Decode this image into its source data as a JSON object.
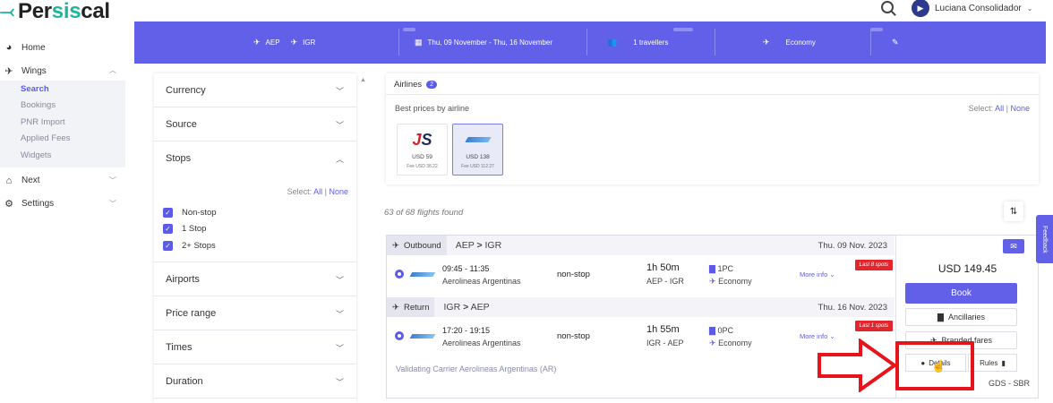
{
  "app": {
    "logo_prefix": "Per",
    "logo_accent": "sis",
    "logo_suffix": "cal"
  },
  "user": {
    "name": "Luciana Consolidador"
  },
  "sidebar": {
    "home": "Home",
    "wings": "Wings",
    "wings_items": [
      "Search",
      "Bookings",
      "PNR Import",
      "Applied Fees",
      "Widgets"
    ],
    "next": "Next",
    "settings": "Settings"
  },
  "searchbar": {
    "origin": "AEP",
    "destination": "IGR",
    "dates": "Thu, 09 November - Thu, 16 November",
    "travellers": "1 travellers",
    "cabin": "Economy"
  },
  "filters": {
    "currency": "Currency",
    "source": "Source",
    "stops": "Stops",
    "select_label": "Select:",
    "all": "All",
    "sep": "|",
    "none": "None",
    "stop_options": [
      "Non-stop",
      "1 Stop",
      "2+ Stops"
    ],
    "airports": "Airports",
    "price_range": "Price range",
    "times": "Times",
    "duration": "Duration"
  },
  "airlines": {
    "tab": "Airlines",
    "badge": "2",
    "best": "Best prices by airline",
    "select_label": "Select:",
    "all": "All",
    "sep": "|",
    "none": "None",
    "cards": [
      {
        "logo_a": "J",
        "logo_b": "S",
        "price": "USD 59",
        "fee": "Fee USD 38.22"
      },
      {
        "price": "USD 138",
        "fee": "Fee USD 112.27"
      }
    ]
  },
  "results": {
    "found": "63 of 68 flights found",
    "outbound": {
      "label": "Outbound",
      "from": "AEP",
      "arrow": ">",
      "to": "IGR",
      "date": "Thu. 09 Nov. 2023",
      "time": "09:45 - 11:35",
      "airline": "Aerolineas Argentinas",
      "stops": "non-stop",
      "duration": "1h 50m",
      "airports": "AEP - IGR",
      "bag": "1PC",
      "cabin": "Economy",
      "more": "More info",
      "last": "Last 8 spots"
    },
    "return": {
      "label": "Return",
      "from": "IGR",
      "arrow": ">",
      "to": "AEP",
      "date": "Thu. 16 Nov. 2023",
      "time": "17:20 - 19:15",
      "airline": "Aerolineas Argentinas",
      "stops": "non-stop",
      "duration": "1h 55m",
      "airports": "IGR - AEP",
      "bag": "0PC",
      "cabin": "Economy",
      "more": "More info",
      "last": "Last 1 spots"
    },
    "validating": "Validating Carrier Aerolineas Argentinas (AR)",
    "price": "USD 149.45",
    "book": "Book",
    "ancillaries": "Ancillaries",
    "branded": "Branded fares",
    "details": "Details",
    "rules": "Rules",
    "gds": "GDS - SBR"
  },
  "feedback": "Feedback",
  "colors": {
    "primary": "#6260e8",
    "accent": "#1fb59a",
    "alert": "#e3262e"
  }
}
